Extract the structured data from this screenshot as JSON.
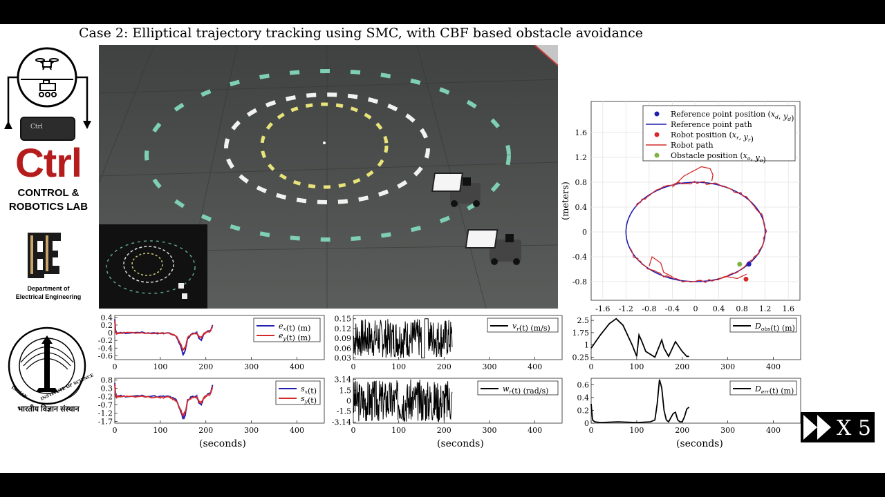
{
  "title": "Case 2: Elliptical trajectory tracking using SMC, with CBF based obstacle avoidance",
  "sidebar": {
    "ctrl_key_label": "Ctrl",
    "ctrl_big": "Ctrl",
    "lab_line1": "CONTROL &",
    "lab_line2": "ROBOTICS LAB",
    "dept_line1": "Department of",
    "dept_line2": "Electrical Engineering",
    "iisc_ring_left": "INDIAN",
    "iisc_ring_right": "INSTITUTE OF SCIENCE",
    "iisc_hindi": "भारतीय विज्ञान संस्थान"
  },
  "speed_badge": {
    "label": "X 5",
    "icon": "fast-forward-icon"
  },
  "colors": {
    "blue": "#1f1fb0",
    "red": "#d42a2a",
    "green": "#7cb342",
    "black": "#000000"
  },
  "chart_data": [
    {
      "id": "trajectory",
      "type": "line",
      "xlabel": "(meters)",
      "ylabel": "(meters)",
      "xlim": [
        -1.8,
        1.8
      ],
      "ylim": [
        -1.1,
        2.1
      ],
      "xticks": [
        -1.6,
        -1.2,
        -0.8,
        -0.4,
        0,
        0.4,
        0.8,
        1.2,
        1.6
      ],
      "yticks": [
        -0.8,
        -0.4,
        0,
        0.4,
        0.8,
        1.2,
        1.6
      ],
      "xtick_labels": [
        "-1.6",
        "-1.2",
        "-0.8",
        "-0.4",
        "0",
        "0.4",
        "0.8",
        "1.2",
        "1.6"
      ],
      "ytick_labels": [
        "-0.8",
        "-0.4",
        "0",
        "0.4",
        "0.8",
        "1.2",
        "1.6"
      ],
      "grid": true,
      "legend_position": "top-right",
      "legend": [
        {
          "label": "Reference point position (x_d, y_d)",
          "kind": "dot",
          "color": "#1f1fb0"
        },
        {
          "label": "Reference point path",
          "kind": "line",
          "color": "#1f1fb0"
        },
        {
          "label": "Robot position (x_r, y_r)",
          "kind": "dot",
          "color": "#d42a2a"
        },
        {
          "label": "Robot path",
          "kind": "line",
          "color": "#d42a2a"
        },
        {
          "label": "Obstacle position (x_o, y_o)",
          "kind": "dot",
          "color": "#7cb342"
        }
      ],
      "ellipse": {
        "cx": 0,
        "cy": 0,
        "rx": 1.2,
        "ry": 0.8
      },
      "robot_detour": [
        [
          -0.4,
          0.72
        ],
        [
          -0.2,
          0.9
        ],
        [
          0.1,
          1.05
        ],
        [
          0.25,
          1.02
        ],
        [
          0.3,
          0.92
        ],
        [
          0.28,
          0.82
        ]
      ],
      "robot_path_bottom_detour": [
        [
          -0.8,
          -0.55
        ],
        [
          -0.75,
          -0.4
        ],
        [
          -0.6,
          -0.5
        ],
        [
          -0.55,
          -0.65
        ],
        [
          -0.4,
          -0.72
        ]
      ],
      "robot_path_end": [
        [
          0.4,
          -0.75
        ],
        [
          0.55,
          -0.72
        ],
        [
          0.72,
          -0.75
        ],
        [
          0.88,
          -0.68
        ]
      ],
      "points": [
        {
          "name": "reference",
          "x": 0.92,
          "y": -0.52,
          "color": "#1f1fb0"
        },
        {
          "name": "robot",
          "x": 0.87,
          "y": -0.76,
          "color": "#d42a2a"
        },
        {
          "name": "obstacle",
          "x": 0.76,
          "y": -0.52,
          "color": "#7cb342"
        }
      ]
    },
    {
      "id": "errors",
      "type": "line",
      "xlim": [
        0,
        460
      ],
      "ylim": [
        -0.7,
        0.45
      ],
      "xticks": [
        0,
        100,
        200,
        300,
        400
      ],
      "yticks": [
        0.4,
        0.2,
        0,
        -0.2,
        -0.4,
        -0.6
      ],
      "ytick_labels": [
        "0.4",
        "0.2",
        "0",
        "-0.2",
        "-0.4",
        "-0.6"
      ],
      "legend_position": "top-right",
      "series": [
        {
          "name": "e_x(t) (m)",
          "color": "#1f1fb0",
          "x": [
            0,
            2,
            5,
            10,
            30,
            60,
            100,
            120,
            135,
            145,
            150,
            155,
            160,
            170,
            180,
            185,
            190,
            195,
            200,
            210,
            215
          ],
          "y": [
            0.35,
            0.05,
            -0.02,
            0.0,
            -0.01,
            0.01,
            -0.02,
            -0.01,
            -0.1,
            -0.35,
            -0.58,
            -0.45,
            -0.15,
            -0.02,
            0.0,
            -0.15,
            -0.2,
            -0.05,
            0.02,
            0.05,
            0.2
          ]
        },
        {
          "name": "e_y(t) (m)",
          "color": "#d42a2a",
          "x": [
            0,
            2,
            5,
            10,
            30,
            60,
            100,
            120,
            135,
            145,
            150,
            155,
            160,
            170,
            180,
            185,
            190,
            195,
            200,
            210,
            215
          ],
          "y": [
            0.3,
            0.02,
            -0.03,
            -0.01,
            0.0,
            -0.01,
            -0.01,
            -0.02,
            -0.08,
            -0.3,
            -0.45,
            -0.38,
            -0.12,
            -0.03,
            -0.01,
            -0.1,
            -0.12,
            -0.03,
            0.0,
            0.04,
            0.18
          ]
        }
      ]
    },
    {
      "id": "vr",
      "type": "line",
      "xlim": [
        0,
        460
      ],
      "ylim": [
        0.025,
        0.16
      ],
      "xticks": [
        0,
        100,
        200,
        300,
        400
      ],
      "yticks": [
        0.15,
        0.12,
        0.09,
        0.06,
        0.03
      ],
      "ytick_labels": [
        "0.15",
        "0.12",
        "0.09",
        "0.06",
        "0.03"
      ],
      "legend_position": "top-right",
      "series": [
        {
          "name": "v_r(t) (m/s)",
          "color": "#000000",
          "noisy": true,
          "x_end": 218,
          "y_min": 0.03,
          "y_max": 0.15,
          "seed": 7
        }
      ]
    },
    {
      "id": "dobs",
      "type": "line",
      "xlim": [
        0,
        460
      ],
      "ylim": [
        0.1,
        2.8
      ],
      "xticks": [
        0,
        100,
        200,
        300,
        400
      ],
      "yticks": [
        2.5,
        1.75,
        1,
        0.25
      ],
      "ytick_labels": [
        "2.5",
        "1.75",
        "1",
        "0.25"
      ],
      "legend_position": "top-right",
      "series": [
        {
          "name": "D_obs(t) (m)",
          "color": "#000000",
          "x": [
            0,
            20,
            40,
            55,
            70,
            90,
            100,
            105,
            110,
            120,
            140,
            155,
            160,
            170,
            185,
            200,
            210,
            215
          ],
          "y": [
            0.8,
            1.6,
            2.3,
            2.6,
            2.2,
            1.0,
            0.3,
            1.6,
            1.3,
            0.6,
            0.25,
            1.3,
            0.8,
            0.3,
            1.2,
            0.6,
            0.3,
            0.3
          ]
        }
      ]
    },
    {
      "id": "sliding",
      "type": "line",
      "xlim": [
        0,
        460
      ],
      "ylim": [
        -1.8,
        0.9
      ],
      "xticks": [
        0,
        100,
        200,
        300,
        400
      ],
      "yticks": [
        0.8,
        0.3,
        -0.2,
        -0.7,
        -1.2,
        -1.7
      ],
      "ytick_labels": [
        "0.8",
        "0.3",
        "-0.2",
        "-0.7",
        "-1.2",
        "-1.7"
      ],
      "legend_position": "top-right",
      "series": [
        {
          "name": "s_x(t)",
          "color": "#1f1fb0",
          "x": [
            0,
            2,
            5,
            10,
            30,
            60,
            100,
            120,
            135,
            145,
            150,
            155,
            160,
            170,
            180,
            185,
            190,
            195,
            200,
            210,
            215
          ],
          "y": [
            0.6,
            -0.1,
            -0.2,
            -0.15,
            -0.2,
            -0.15,
            -0.2,
            -0.2,
            -0.4,
            -1.1,
            -1.55,
            -1.3,
            -0.4,
            -0.2,
            -0.2,
            -0.6,
            -0.7,
            -0.3,
            -0.15,
            0.0,
            0.5
          ]
        },
        {
          "name": "s_y(t)",
          "color": "#d42a2a",
          "x": [
            0,
            2,
            5,
            10,
            30,
            60,
            100,
            120,
            135,
            145,
            150,
            155,
            160,
            170,
            180,
            185,
            190,
            195,
            200,
            210,
            215
          ],
          "y": [
            0.5,
            -0.15,
            -0.25,
            -0.2,
            -0.22,
            -0.2,
            -0.25,
            -0.25,
            -0.45,
            -1.0,
            -1.35,
            -1.1,
            -0.45,
            -0.25,
            -0.22,
            -0.5,
            -0.55,
            -0.3,
            -0.2,
            -0.05,
            0.4
          ]
        }
      ]
    },
    {
      "id": "wr",
      "type": "line",
      "xlim": [
        0,
        460
      ],
      "ylim": [
        -3.3,
        3.3
      ],
      "xticks": [
        0,
        100,
        200,
        300,
        400
      ],
      "yticks": [
        3.14,
        1.5,
        0,
        -1.5,
        -3.14
      ],
      "ytick_labels": [
        "3.14",
        "1.5",
        "0",
        "-1.5",
        "-3.14"
      ],
      "xlabel": "(seconds)",
      "legend_position": "top-right",
      "series": [
        {
          "name": "w_r(t) (rad/s)",
          "color": "#000000",
          "noisy": true,
          "x_end": 218,
          "y_min": -3.14,
          "y_max": 3.14,
          "seed": 3
        }
      ]
    },
    {
      "id": "derr",
      "type": "line",
      "xlim": [
        0,
        460
      ],
      "ylim": [
        0,
        0.7
      ],
      "xticks": [
        0,
        100,
        200,
        300,
        400
      ],
      "yticks": [
        0.6,
        0.4,
        0.2,
        0
      ],
      "ytick_labels": [
        "0.6",
        "0.4",
        "0.2",
        "0"
      ],
      "xlabel": "(seconds)",
      "legend_position": "top-right",
      "series": [
        {
          "name": "D_err(t) (m)",
          "color": "#000000",
          "x": [
            0,
            3,
            8,
            20,
            60,
            100,
            130,
            140,
            145,
            150,
            155,
            160,
            165,
            170,
            180,
            185,
            190,
            195,
            200,
            205,
            210,
            215
          ],
          "y": [
            0.3,
            0.05,
            0.02,
            0.01,
            0.02,
            0.01,
            0.02,
            0.05,
            0.3,
            0.68,
            0.55,
            0.2,
            0.05,
            0.02,
            0.15,
            0.17,
            0.05,
            0.02,
            0.02,
            0.1,
            0.22,
            0.25
          ]
        }
      ]
    }
  ],
  "axis_xlabel_left": "(seconds)",
  "axis_xlabel_right": "(seconds)",
  "xtick_labels_time": [
    "0",
    "100",
    "200",
    "300",
    "400"
  ]
}
